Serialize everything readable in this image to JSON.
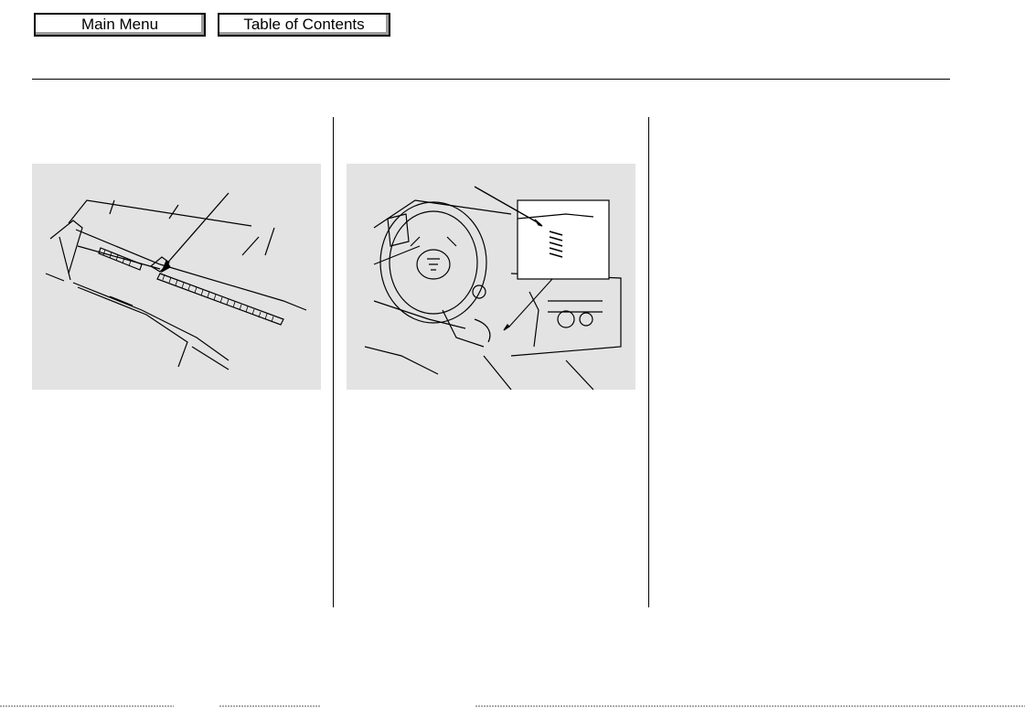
{
  "nav": {
    "main_menu_label": "Main Menu",
    "toc_label": "Table of Contents"
  },
  "colors": {
    "figure_background": "#e3e3e3",
    "rule": "#000000"
  },
  "icons": {
    "wiper": "windshield-wiper-illustration-icon",
    "steering": "steering-column-illustration-icon"
  }
}
